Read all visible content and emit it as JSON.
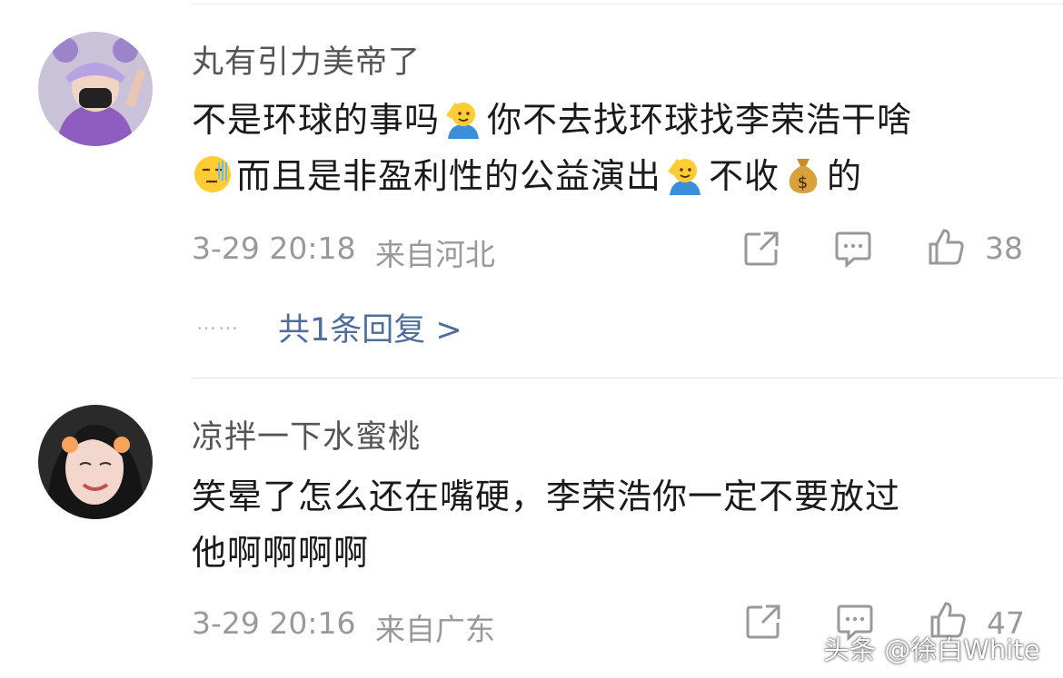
{
  "comments": [
    {
      "username": "丸有引力美帝了",
      "line1_a": "不是环球的事吗",
      "line1_b": "你不去找环球找李荣浩干啥",
      "line2_a": "而且是非盈利性的公益演出",
      "line2_b": "不收",
      "line2_c": "的",
      "emojis": [
        "salute-face-emoji",
        "cold-sweat-face-emoji",
        "salute-face-emoji",
        "money-bag-emoji"
      ],
      "time": "3-29 20:18",
      "location": "来自河北",
      "like_count": "38",
      "replies_link": "共1条回复 >",
      "replies_dots": "……"
    },
    {
      "username": "凉拌一下水蜜桃",
      "line1": "笑晕了怎么还在嘴硬，李荣浩你一定不要放过",
      "line2": "他啊啊啊啊",
      "time": "3-29 20:16",
      "location": "来自广东",
      "like_count": "47"
    }
  ],
  "icons": [
    "share-icon",
    "comment-icon",
    "like-icon"
  ],
  "colors": {
    "link": "#4f6e99",
    "meta": "#999999",
    "username": "#555555",
    "text": "#1a1a1a"
  },
  "watermark": "头条 @徐白White"
}
